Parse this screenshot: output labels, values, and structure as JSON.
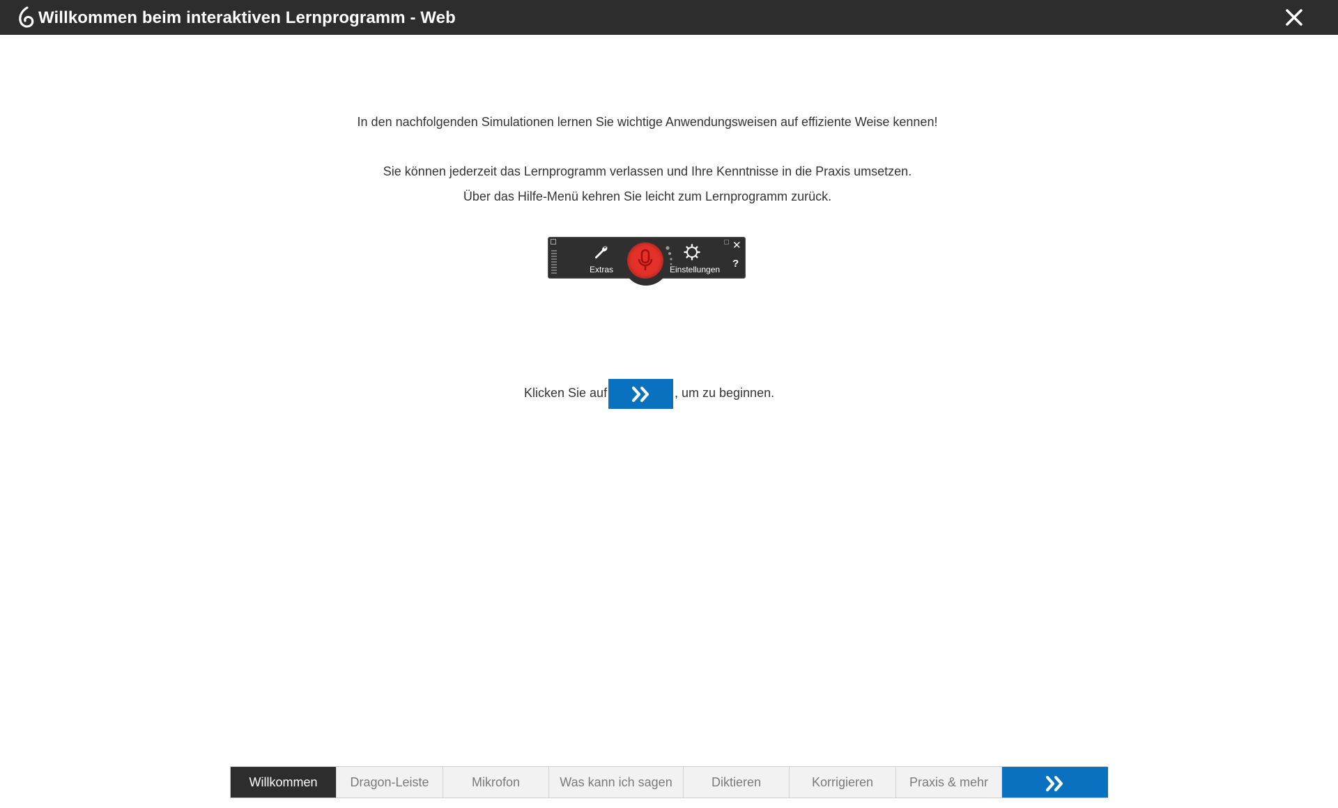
{
  "window": {
    "title": "Willkommen beim interaktiven Lernprogramm - Web"
  },
  "intro": {
    "line1": "In den nachfolgenden Simulationen lernen Sie wichtige Anwendungsweisen auf effiziente Weise kennen!",
    "line2": "Sie können jederzeit das Lernprogramm verlassen und Ihre Kenntnisse in die Praxis umsetzen.",
    "line3": "Über das Hilfe-Menü kehren Sie leicht zum Lernprogramm zurück."
  },
  "dragon_bar": {
    "extras_label": "Extras",
    "settings_label": "Einstellungen",
    "help_label": "?",
    "close_label": "✕",
    "mic_color": "#e4322b"
  },
  "start": {
    "prefix": "Klicken Sie auf",
    "suffix": ", um zu beginnen."
  },
  "nav": {
    "tabs": [
      {
        "label": "Willkommen",
        "active": true
      },
      {
        "label": "Dragon-Leiste",
        "active": false
      },
      {
        "label": "Mikrofon",
        "active": false
      },
      {
        "label": "Was kann ich sagen",
        "active": false
      },
      {
        "label": "Diktieren",
        "active": false
      },
      {
        "label": "Korrigieren",
        "active": false
      },
      {
        "label": "Praxis & mehr",
        "active": false
      }
    ]
  },
  "colors": {
    "accent": "#0a71c1",
    "titlebar": "#2d2d2d"
  },
  "icons": {
    "logo": "dragon-logo-icon",
    "close": "close-icon",
    "next": "double-chevron-right-icon"
  }
}
